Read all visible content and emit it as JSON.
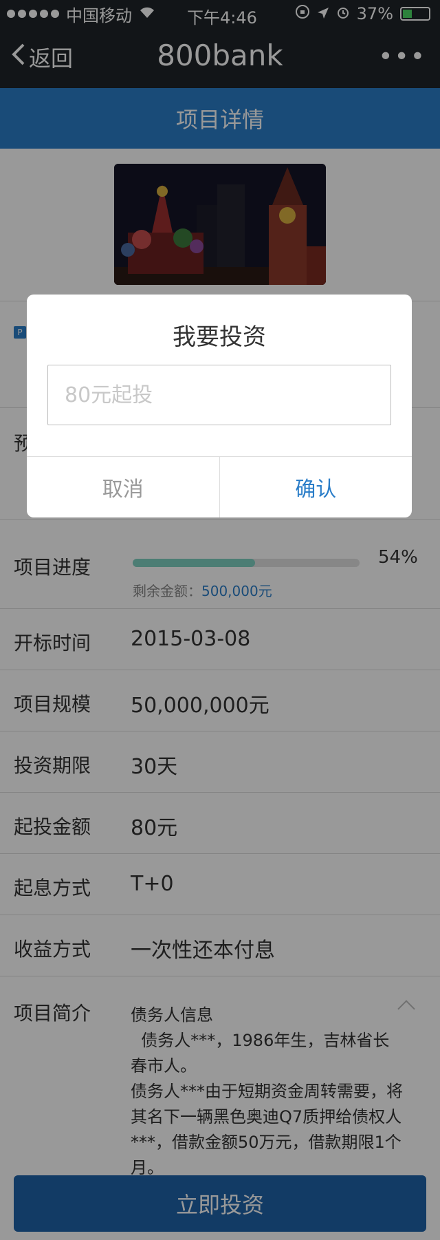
{
  "status_bar": {
    "carrier": "中国移动",
    "time": "下午4:46",
    "battery": "37%",
    "battery_level": 0.37
  },
  "nav": {
    "back_label": "返回",
    "title": "800bank",
    "more_label": "•••"
  },
  "subheader": {
    "title": "项目详情"
  },
  "info": {
    "badge": "P",
    "pre_char": "预"
  },
  "progress": {
    "label": "项目进度",
    "percent_text": "54%",
    "percent_value": 0.54,
    "remaining_label": "剩余金额：",
    "remaining_amount": "500,000元"
  },
  "details": [
    {
      "label": "开标时间",
      "value": "2015-03-08"
    },
    {
      "label": "项目规模",
      "value": "50,000,000元"
    },
    {
      "label": "投资期限",
      "value": "30天"
    },
    {
      "label": "起投金额",
      "value": "80元"
    },
    {
      "label": "起息方式",
      "value": "T+0"
    },
    {
      "label": "收益方式",
      "value": "一次性还本付息"
    }
  ],
  "intro": {
    "label": "项目简介",
    "lines": [
      "债务人信息",
      "  债务人***，1986年生，吉林省长春市人。",
      "债务人***由于短期资金周转需要，将其名下一辆黑色奥迪Q7质押给债权人***，借款金额50万元，借款期限1个月。"
    ]
  },
  "invest_button": "立即投资",
  "modal": {
    "title": "我要投资",
    "input_placeholder": "80元起投",
    "cancel": "取消",
    "confirm": "确认"
  }
}
